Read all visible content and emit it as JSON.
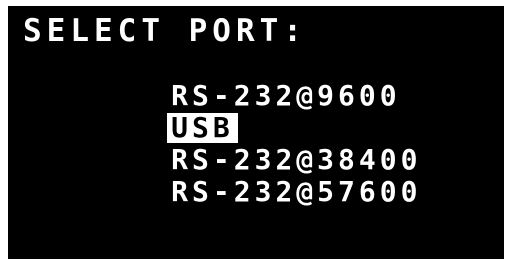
{
  "screen": {
    "title": "SELECT PORT:",
    "items": [
      {
        "label": "RS-232@9600",
        "selected": false
      },
      {
        "label": "USB",
        "selected": true
      },
      {
        "label": "RS-232@38400",
        "selected": false
      },
      {
        "label": "RS-232@57600",
        "selected": false
      }
    ]
  },
  "colors": {
    "background": "#000000",
    "text": "#ffffff",
    "highlight_bg": "#ffffff",
    "highlight_text": "#000000"
  }
}
